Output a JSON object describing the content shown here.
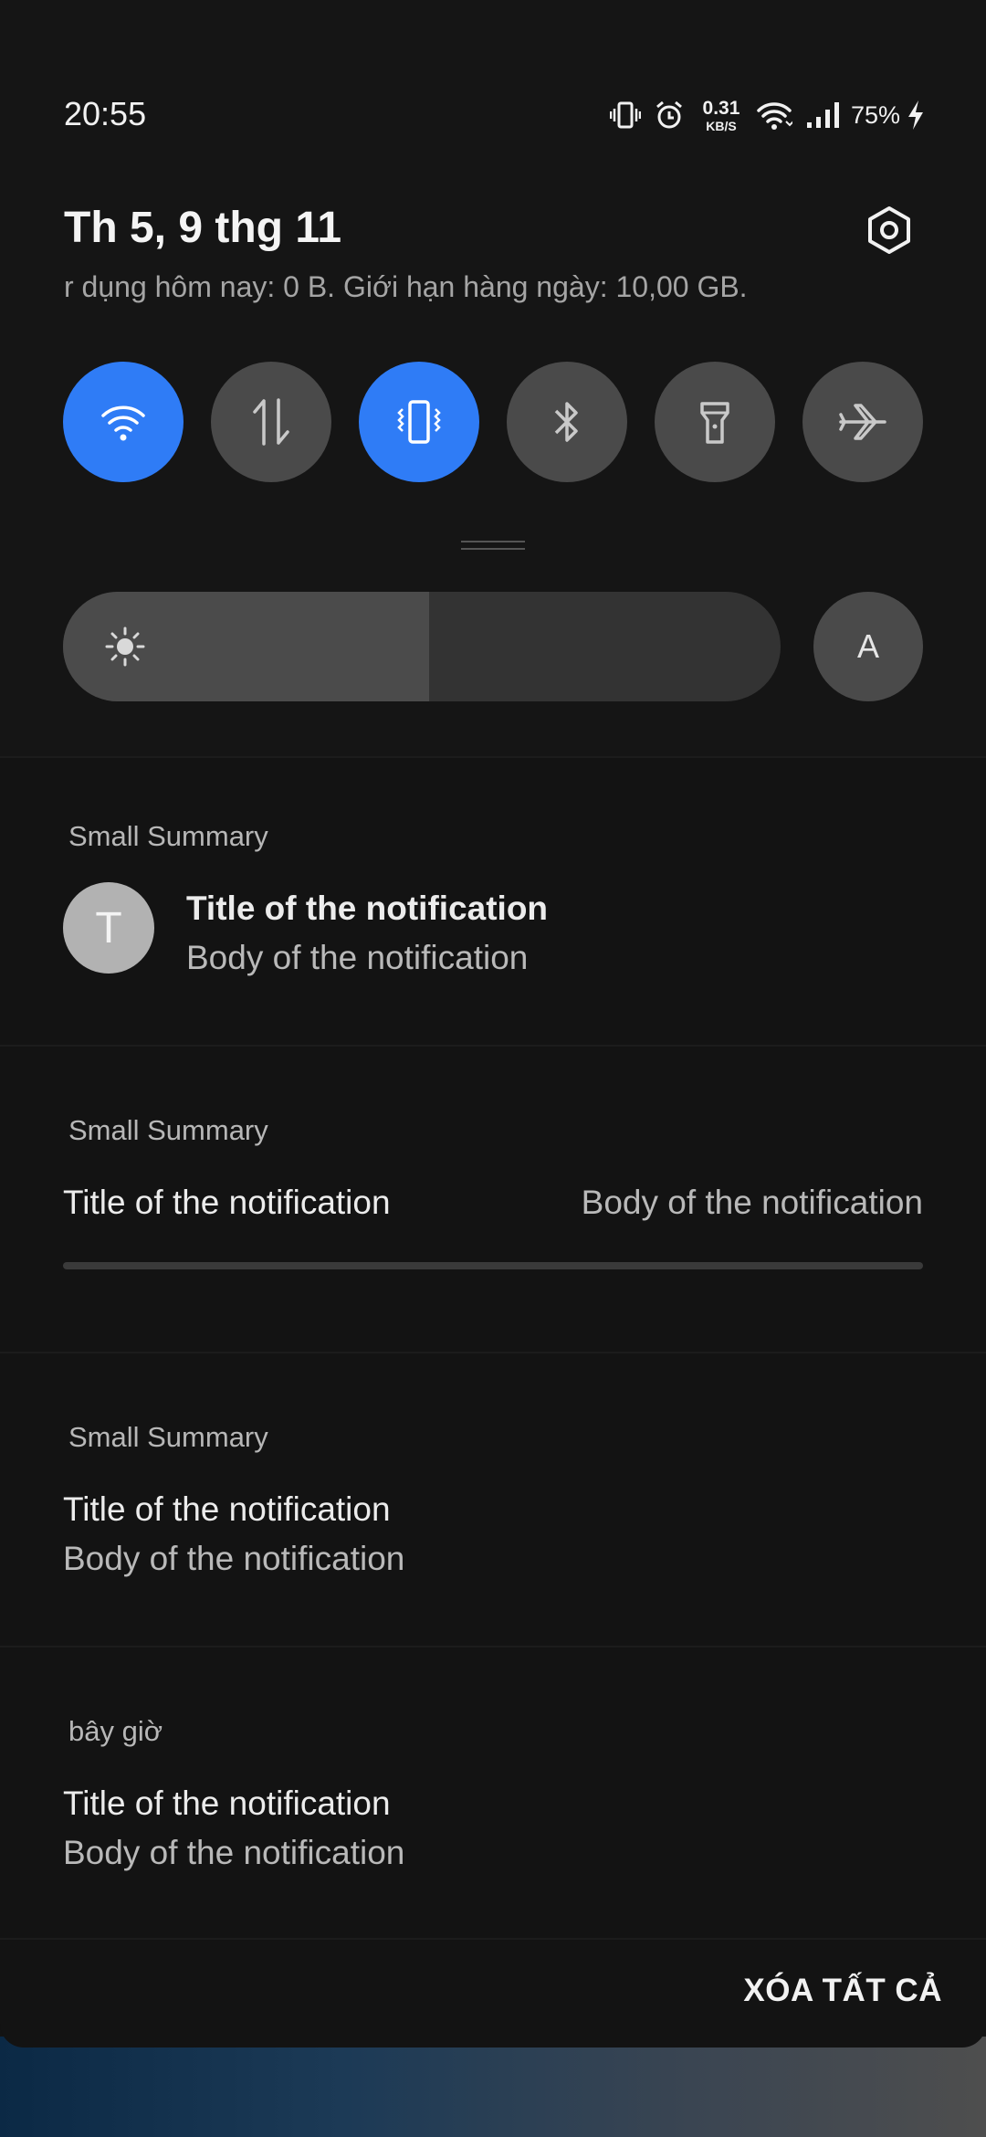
{
  "status_bar": {
    "time": "20:55",
    "net_speed_value": "0.31",
    "net_speed_unit": "KB/S",
    "battery_percent": "75%",
    "icons": [
      "vibrate-icon",
      "alarm-icon",
      "wifi-icon",
      "cellular-signal-icon",
      "battery-charging-icon"
    ]
  },
  "header": {
    "date": "Th 5, 9 thg 11",
    "data_usage": "r dụng hôm nay: 0 B. Giới hạn hàng ngày: 10,00 GB."
  },
  "quick_toggles": [
    {
      "name": "wifi",
      "icon": "wifi-icon",
      "active": true
    },
    {
      "name": "mobile-data",
      "icon": "data-arrows-icon",
      "active": false
    },
    {
      "name": "vibrate",
      "icon": "vibrate-icon",
      "active": true
    },
    {
      "name": "bluetooth",
      "icon": "bluetooth-icon",
      "active": false
    },
    {
      "name": "flashlight",
      "icon": "flashlight-icon",
      "active": false
    },
    {
      "name": "airplane-mode",
      "icon": "airplane-icon",
      "active": false
    }
  ],
  "brightness": {
    "level": 0.51,
    "auto_label": "A"
  },
  "notifications": [
    {
      "summary": "Small Summary",
      "avatar_letter": "T",
      "title": "Title of the notification",
      "body": "Body of the notification"
    },
    {
      "summary": "Small Summary",
      "title": "Title of the notification",
      "body": "Body of the notification",
      "progress": 0.0
    },
    {
      "summary": "Small Summary",
      "title": "Title of the notification",
      "body": "Body of the notification"
    },
    {
      "summary": "bây giờ",
      "title": "Title of the notification",
      "body": "Body of the notification"
    }
  ],
  "clear_all_label": "XÓA TẤT CẢ",
  "colors": {
    "accent": "#2f7cf6",
    "background": "#131313",
    "toggle_off": "#4a4a4a"
  }
}
